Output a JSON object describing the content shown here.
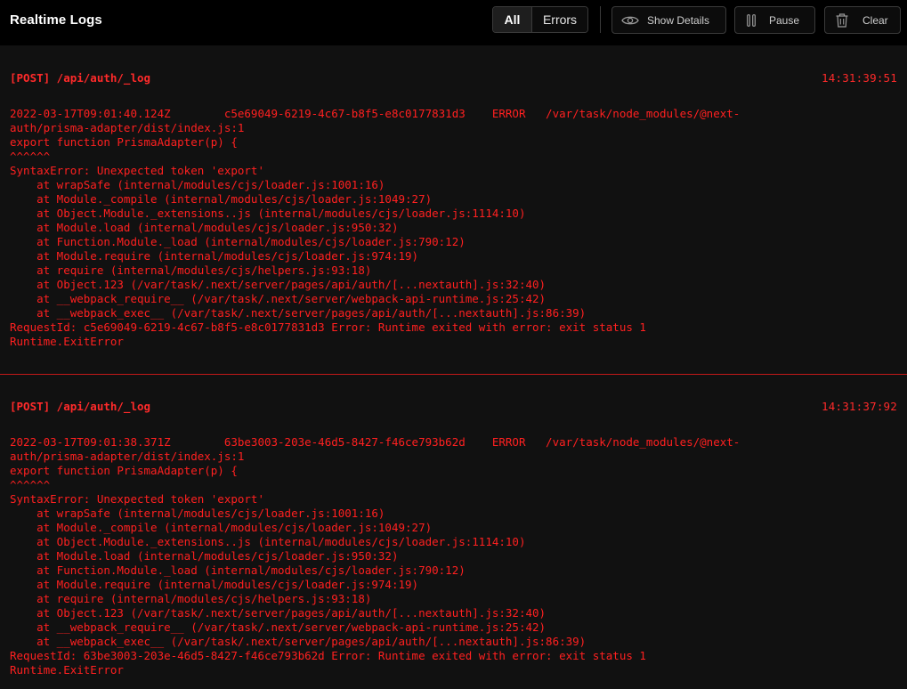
{
  "header": {
    "title": "Realtime Logs",
    "filters": [
      {
        "label": "All",
        "active": true
      },
      {
        "label": "Errors",
        "active": false
      }
    ],
    "show_details_label": "Show Details",
    "pause_label": "Pause",
    "clear_label": "Clear"
  },
  "colors": {
    "error_red": "#ff2020",
    "background": "#111111",
    "topbar": "#000000",
    "divider": "#c21818"
  },
  "logs": [
    {
      "method_path": "[POST] /api/auth/_log",
      "time": "14:31:39:51",
      "lines": [
        "2022-03-17T09:01:40.124Z        c5e69049-6219-4c67-b8f5-e8c0177831d3    ERROR   /var/task/node_modules/@next-",
        "auth/prisma-adapter/dist/index.js:1",
        "export function PrismaAdapter(p) {",
        "^^^^^^",
        "SyntaxError: Unexpected token 'export'",
        "    at wrapSafe (internal/modules/cjs/loader.js:1001:16)",
        "    at Module._compile (internal/modules/cjs/loader.js:1049:27)",
        "    at Object.Module._extensions..js (internal/modules/cjs/loader.js:1114:10)",
        "    at Module.load (internal/modules/cjs/loader.js:950:32)",
        "    at Function.Module._load (internal/modules/cjs/loader.js:790:12)",
        "    at Module.require (internal/modules/cjs/loader.js:974:19)",
        "    at require (internal/modules/cjs/helpers.js:93:18)",
        "    at Object.123 (/var/task/.next/server/pages/api/auth/[...nextauth].js:32:40)",
        "    at __webpack_require__ (/var/task/.next/server/webpack-api-runtime.js:25:42)",
        "    at __webpack_exec__ (/var/task/.next/server/pages/api/auth/[...nextauth].js:86:39)",
        "RequestId: c5e69049-6219-4c67-b8f5-e8c0177831d3 Error: Runtime exited with error: exit status 1",
        "Runtime.ExitError"
      ]
    },
    {
      "method_path": "[POST] /api/auth/_log",
      "time": "14:31:37:92",
      "lines": [
        "2022-03-17T09:01:38.371Z        63be3003-203e-46d5-8427-f46ce793b62d    ERROR   /var/task/node_modules/@next-",
        "auth/prisma-adapter/dist/index.js:1",
        "export function PrismaAdapter(p) {",
        "^^^^^^",
        "SyntaxError: Unexpected token 'export'",
        "    at wrapSafe (internal/modules/cjs/loader.js:1001:16)",
        "    at Module._compile (internal/modules/cjs/loader.js:1049:27)",
        "    at Object.Module._extensions..js (internal/modules/cjs/loader.js:1114:10)",
        "    at Module.load (internal/modules/cjs/loader.js:950:32)",
        "    at Function.Module._load (internal/modules/cjs/loader.js:790:12)",
        "    at Module.require (internal/modules/cjs/loader.js:974:19)",
        "    at require (internal/modules/cjs/helpers.js:93:18)",
        "    at Object.123 (/var/task/.next/server/pages/api/auth/[...nextauth].js:32:40)",
        "    at __webpack_require__ (/var/task/.next/server/webpack-api-runtime.js:25:42)",
        "    at __webpack_exec__ (/var/task/.next/server/pages/api/auth/[...nextauth].js:86:39)",
        "RequestId: 63be3003-203e-46d5-8427-f46ce793b62d Error: Runtime exited with error: exit status 1",
        "Runtime.ExitError"
      ]
    }
  ]
}
